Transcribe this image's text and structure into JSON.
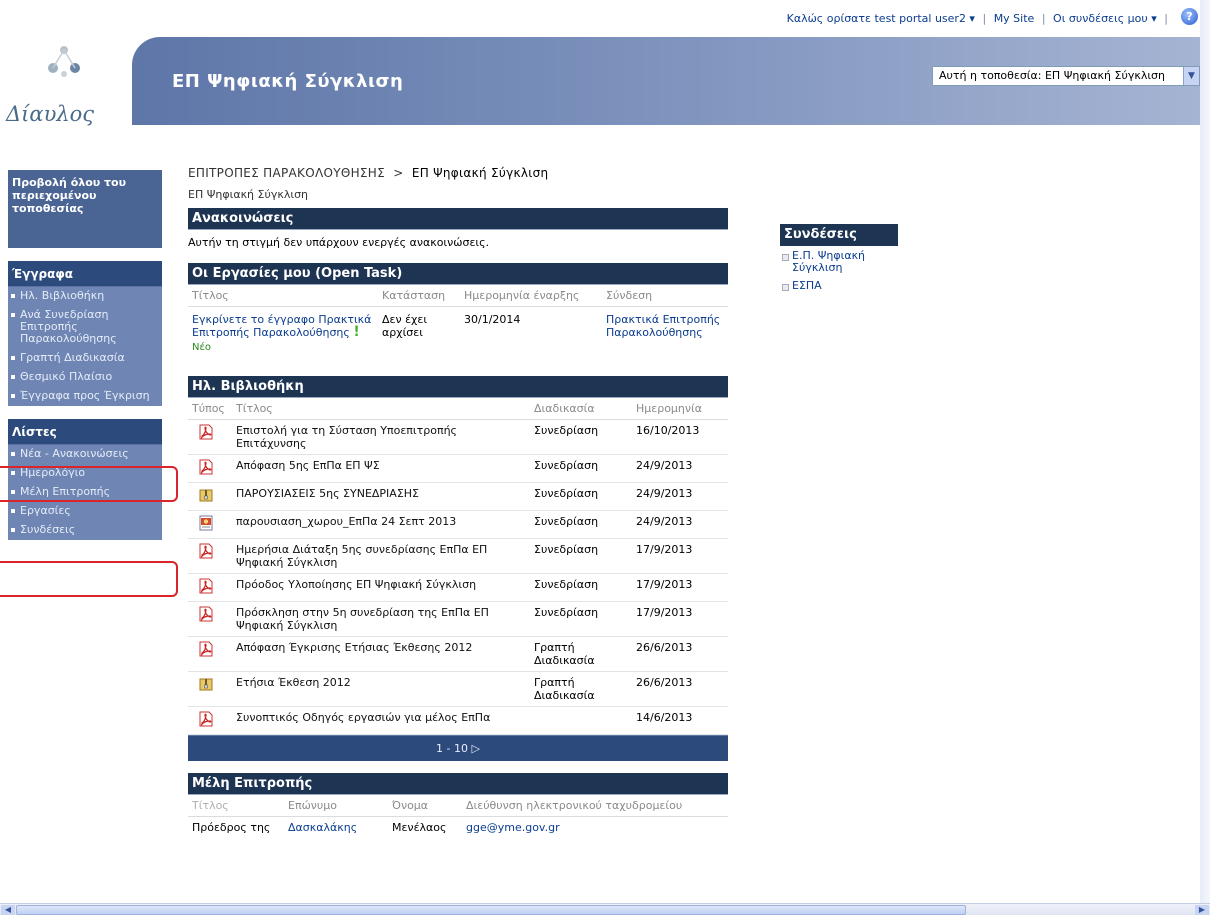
{
  "topbar": {
    "welcome": "Καλώς ορίσατε test portal user2 ▾",
    "my_site": "My Site",
    "my_links": "Οι συνδέσεις μου ▾"
  },
  "header": {
    "logo_text": "Δίαυλος",
    "site_title": "ΕΠ Ψηφιακή Σύγκλιση",
    "search_scope": "Αυτή η τοποθεσία: ΕΠ Ψηφιακή Σύγκλιση"
  },
  "leftnav": {
    "view_all": "Προβολή όλου του περιεχομένου τοποθεσίας",
    "docs_head": "Έγγραφα",
    "docs_items": [
      "Ηλ. Βιβλιοθήκη",
      "Ανά Συνεδρίαση Επιτροπής Παρακολούθησης",
      "Γραπτή Διαδικασία",
      "Θεσμικό Πλαίσιο",
      "Έγγραφα προς Έγκριση"
    ],
    "lists_head": "Λίστες",
    "lists_items": [
      "Νέα - Ανακοινώσεις",
      "Ημερολόγιο",
      "Μέλη Επιτροπής",
      "Εργασίες",
      "Συνδέσεις"
    ]
  },
  "breadcrumb": {
    "parent": "ΕΠΙΤΡΟΠΕΣ ΠΑΡΑΚΟΛΟΥΘΗΣΗΣ",
    "sep": ">",
    "current": "ΕΠ Ψηφιακή Σύγκλιση"
  },
  "page_sub": "ΕΠ Ψηφιακή Σύγκλιση",
  "announcements": {
    "title": "Ανακοινώσεις",
    "empty": "Αυτήν τη στιγμή δεν υπάρχουν ενεργές ανακοινώσεις."
  },
  "tasks": {
    "title": "Οι Εργασίες μου (Open Task)",
    "headers": [
      "Τίτλος",
      "Κατάσταση",
      "Ημερομηνία έναρξης",
      "Σύνδεση"
    ],
    "row": {
      "title": "Εγκρίνετε το έγγραφο Πρακτικά Επιτροπής Παρακολούθησης",
      "new_label": "Νέο",
      "status": "Δεν έχει αρχίσει",
      "start": "30/1/2014",
      "link": "Πρακτικά Επιτροπής Παρακολούθησης"
    }
  },
  "library": {
    "title": "Ηλ. Βιβλιοθήκη",
    "headers": [
      "Τύπος",
      "Τίτλος",
      "Διαδικασία",
      "Ημερομηνία"
    ],
    "rows": [
      {
        "type": "pdf",
        "title": "Επιστολή για τη Σύσταση Υποεπιτροπής Επιτάχυνσης",
        "process": "Συνεδρίαση",
        "date": "16/10/2013"
      },
      {
        "type": "pdf",
        "title": "Απόφαση 5ης ΕπΠα ΕΠ ΨΣ",
        "process": "Συνεδρίαση",
        "date": "24/9/2013"
      },
      {
        "type": "zip",
        "title": "ΠΑΡΟΥΣΙΑΣΕΙΣ 5ης ΣΥΝΕΔΡΙΑΣΗΣ",
        "process": "Συνεδρίαση",
        "date": "24/9/2013"
      },
      {
        "type": "ppt",
        "title": "παρουσιαση_χωρου_ΕπΠα 24 Σεπτ 2013",
        "process": "Συνεδρίαση",
        "date": "24/9/2013"
      },
      {
        "type": "pdf",
        "title": "Ημερήσια Διάταξη 5ης συνεδρίασης ΕπΠα ΕΠ Ψηφιακή Σύγκλιση",
        "process": "Συνεδρίαση",
        "date": "17/9/2013"
      },
      {
        "type": "pdf",
        "title": "Πρόοδος Υλοποίησης ΕΠ Ψηφιακή Σύγκλιση",
        "process": "Συνεδρίαση",
        "date": "17/9/2013"
      },
      {
        "type": "pdf",
        "title": "Πρόσκληση στην 5η συνεδρίαση της ΕπΠα ΕΠ Ψηφιακή Σύγκλιση",
        "process": "Συνεδρίαση",
        "date": "17/9/2013"
      },
      {
        "type": "pdf",
        "title": "Απόφαση Έγκρισης Ετήσιας Έκθεσης 2012",
        "process": "Γραπτή Διαδικασία",
        "date": "26/6/2013"
      },
      {
        "type": "zip",
        "title": "Ετήσια Έκθεση 2012",
        "process": "Γραπτή Διαδικασία",
        "date": "26/6/2013"
      },
      {
        "type": "pdf",
        "title": "Συνοπτικός Οδηγός εργασιών για μέλος ΕπΠα",
        "process": "",
        "date": "14/6/2013"
      }
    ],
    "paging": "1 - 10 ▷"
  },
  "members": {
    "title": "Μέλη Επιτροπής",
    "headers": [
      "Τίτλος",
      "Επώνυμο",
      "Όνομα",
      "Διεύθυνση ηλεκτρονικού ταχυδρομείου"
    ],
    "row": {
      "title": "Πρόεδρος της",
      "surname": "Δασκαλάκης",
      "name": "Μενέλαος",
      "email": "gge@yme.gov.gr"
    }
  },
  "links": {
    "title": "Συνδέσεις",
    "items": [
      "Ε.Π. Ψηφιακή Σύγκλιση",
      "ΕΣΠΑ"
    ]
  },
  "colors": {
    "webpart_title": "#1e3453",
    "nav_dark": "#2d4a7c",
    "nav_light": "#6f86b4",
    "highlight": "#d9242a",
    "link": "#0b3d8f"
  }
}
